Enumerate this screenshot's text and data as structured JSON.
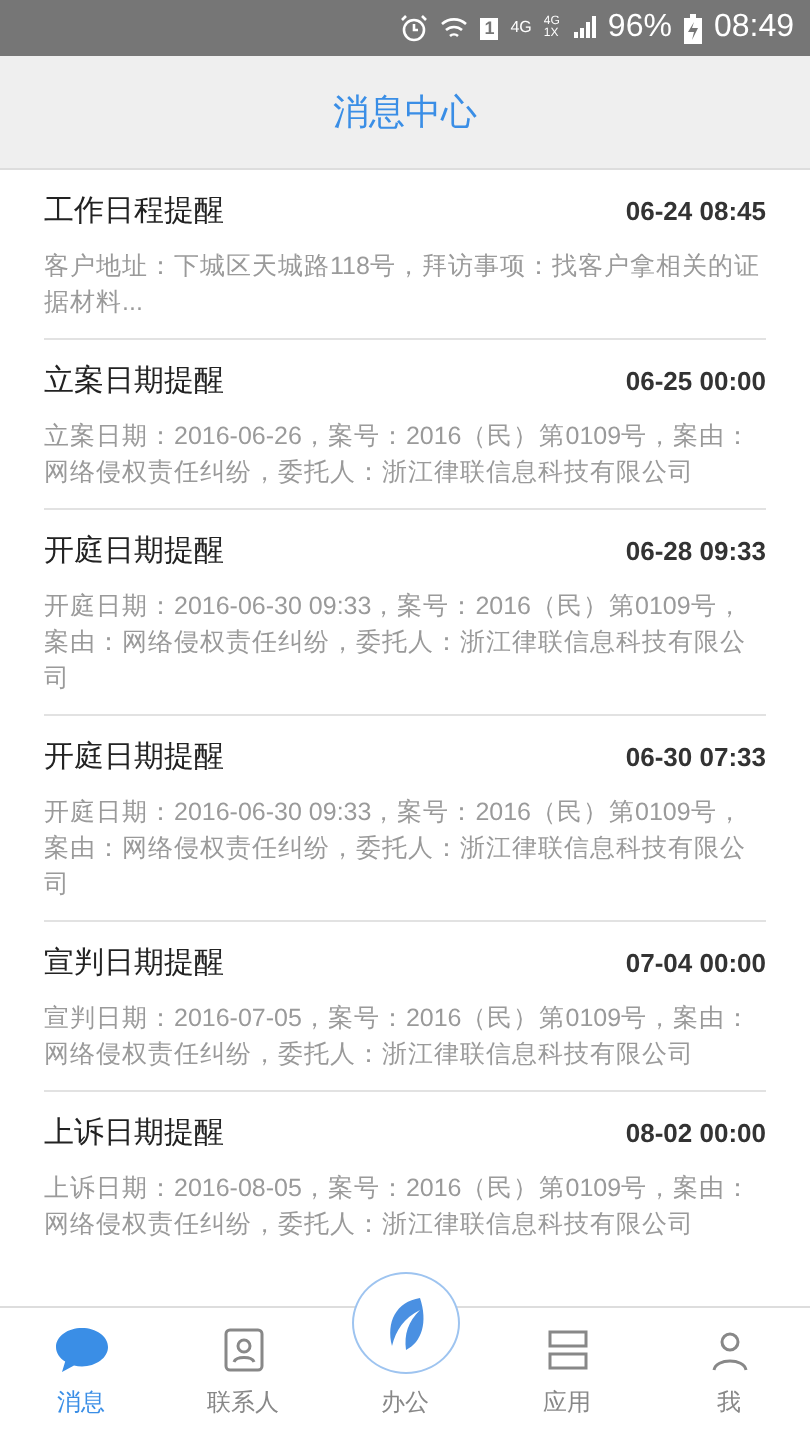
{
  "status_bar": {
    "sim": "1",
    "network_1": "4G",
    "network_2_top": "4G",
    "network_2_bottom": "1X",
    "battery": "96%",
    "time": "08:49"
  },
  "header": {
    "title": "消息中心"
  },
  "messages": [
    {
      "title": "工作日程提醒",
      "time": "06-24 08:45",
      "body": "客户地址：下城区天城路118号，拜访事项：找客户拿相关的证据材料..."
    },
    {
      "title": "立案日期提醒",
      "time": "06-25 00:00",
      "body": "立案日期：2016-06-26，案号：2016（民）第0109号，案由：网络侵权责任纠纷，委托人：浙江律联信息科技有限公司"
    },
    {
      "title": "开庭日期提醒",
      "time": "06-28 09:33",
      "body": "开庭日期：2016-06-30 09:33，案号：2016（民）第0109号，案由：网络侵权责任纠纷，委托人：浙江律联信息科技有限公司"
    },
    {
      "title": "开庭日期提醒",
      "time": "06-30 07:33",
      "body": "开庭日期：2016-06-30 09:33，案号：2016（民）第0109号，案由：网络侵权责任纠纷，委托人：浙江律联信息科技有限公司"
    },
    {
      "title": "宣判日期提醒",
      "time": "07-04 00:00",
      "body": "宣判日期：2016-07-05，案号：2016（民）第0109号，案由：网络侵权责任纠纷，委托人：浙江律联信息科技有限公司"
    },
    {
      "title": "上诉日期提醒",
      "time": "08-02 00:00",
      "body": "上诉日期：2016-08-05，案号：2016（民）第0109号，案由：网络侵权责任纠纷，委托人：浙江律联信息科技有限公司"
    }
  ],
  "tabs": [
    {
      "kind": "messages",
      "label": "消息",
      "selected": true
    },
    {
      "kind": "contacts",
      "label": "联系人",
      "selected": false
    },
    {
      "kind": "office",
      "label": "办公",
      "selected": false
    },
    {
      "kind": "apps",
      "label": "应用",
      "selected": false
    },
    {
      "kind": "me",
      "label": "我",
      "selected": false
    }
  ]
}
